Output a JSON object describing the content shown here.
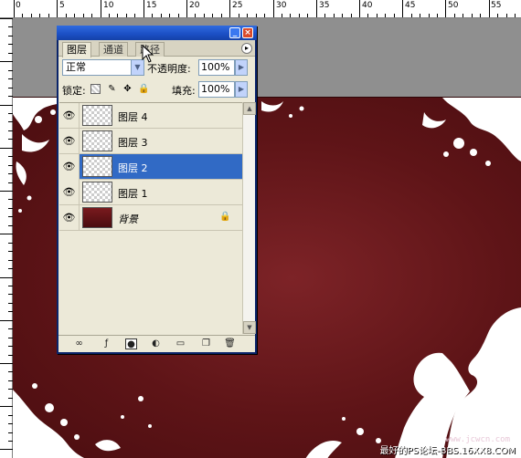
{
  "ruler": {
    "top_labels": [
      "0",
      "5",
      "10",
      "15",
      "20",
      "25",
      "30",
      "35",
      "40",
      "45",
      "50",
      "55"
    ]
  },
  "layers_panel": {
    "tabs": [
      {
        "label": "图层",
        "active": true
      },
      {
        "label": "通道",
        "active": false
      },
      {
        "label": "路径",
        "active": false
      }
    ],
    "blend_mode": "正常",
    "opacity_label": "不透明度:",
    "opacity_value": "100%",
    "lock_label": "锁定:",
    "fill_label": "填充:",
    "fill_value": "100%",
    "layers": [
      {
        "name": "图层 4",
        "visible": true,
        "selected": false,
        "type": "transparent"
      },
      {
        "name": "图层 3",
        "visible": true,
        "selected": false,
        "type": "transparent"
      },
      {
        "name": "图层 2",
        "visible": true,
        "selected": true,
        "type": "transparent"
      },
      {
        "name": "图层 1",
        "visible": true,
        "selected": false,
        "type": "transparent"
      },
      {
        "name": "背景",
        "visible": true,
        "selected": false,
        "type": "background",
        "locked": true
      }
    ],
    "footer_icons": [
      "link-icon",
      "layer-style-icon",
      "mask-icon",
      "adjustment-icon",
      "folder-icon",
      "new-layer-icon",
      "trash-icon"
    ]
  },
  "canvas": {
    "background_color": "#6b1a1e",
    "watermark": "最好的PS论坛-BBS.16XX8.COM",
    "watermark_url": "www.jcwcn.com"
  },
  "colors": {
    "titlebar": "#1b4fc4",
    "selection": "#316ac5",
    "panel_bg": "#ece9d8"
  }
}
